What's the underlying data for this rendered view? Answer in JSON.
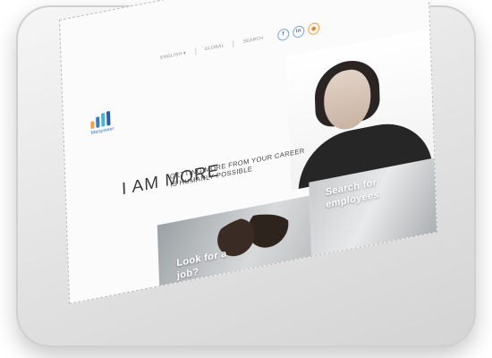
{
  "brand": {
    "name": "Manpower",
    "logo_colors": [
      "#f0a04a",
      "#3a7cc1",
      "#4bb3d8",
      "#2b5ea8"
    ]
  },
  "nav": {
    "language": "ENGLISH",
    "language_icon": "chevron-down-icon",
    "global": "GLOBAL",
    "search": "SEARCH",
    "social_icons": [
      "facebook-icon",
      "linkedin-icon",
      "rss-icon"
    ]
  },
  "hero": {
    "headline": "I AM MORE",
    "subline": "GETTING MORE FROM YOUR CAREER IS HUMANLY POSSIBLE"
  },
  "tiles": {
    "job": "Look for a job?",
    "employee": "Search for employees"
  }
}
